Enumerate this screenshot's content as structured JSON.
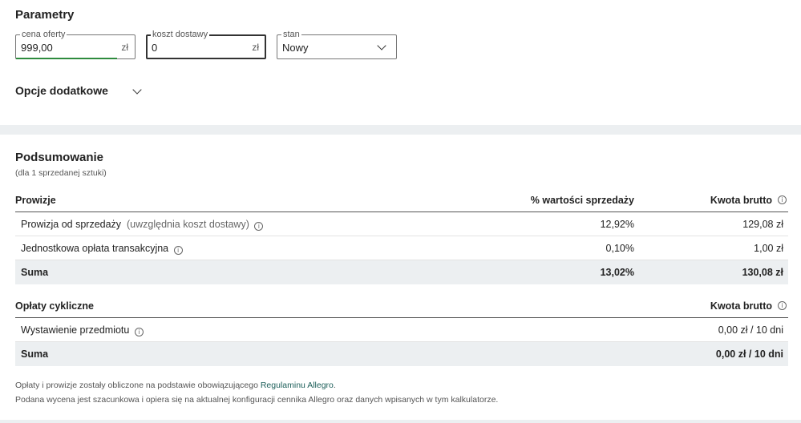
{
  "params": {
    "title": "Parametry",
    "price": {
      "label": "cena oferty",
      "value": "999,00",
      "unit": "zł"
    },
    "shipping": {
      "label": "koszt dostawy",
      "value": "0",
      "unit": "zł"
    },
    "condition": {
      "label": "stan",
      "value": "Nowy"
    },
    "extra_options": "Opcje dodatkowe"
  },
  "summary": {
    "title": "Podsumowanie",
    "subtitle": "(dla 1 sprzedanej sztuki)",
    "commissions": {
      "headers": [
        "Prowizje",
        "% wartości sprzedaży",
        "Kwota brutto"
      ],
      "rows": [
        {
          "label": "Prowizja od sprzedaży",
          "note": "(uwzględnia koszt dostawy)",
          "percent": "12,92%",
          "amount": "129,08 zł"
        },
        {
          "label": "Jednostkowa opłata transakcyjna",
          "percent": "0,10%",
          "amount": "1,00 zł"
        }
      ],
      "sum": {
        "label": "Suma",
        "percent": "13,02%",
        "amount": "130,08 zł"
      }
    },
    "cyclic": {
      "headers": [
        "Opłaty cykliczne",
        "Kwota brutto"
      ],
      "rows": [
        {
          "label": "Wystawienie przedmiotu",
          "amount": "0,00 zł / 10 dni"
        }
      ],
      "sum": {
        "label": "Suma",
        "amount": "0,00 zł / 10 dni"
      }
    },
    "footnote1_pre": "Opłaty i prowizje zostały obliczone na podstawie obowiązującego ",
    "footnote1_link": "Regulaminu Allegro",
    "footnote1_post": ".",
    "footnote2": "Podana wycena jest szacunkowa i opiera się na aktualnej konfiguracji cennika Allegro oraz danych wpisanych w tym kalkulatorze."
  },
  "icons": {
    "info": "info-icon",
    "chevron": "chevron-down-icon"
  },
  "colors": {
    "accent_green": "#2e8b3e",
    "link": "#1d5f5a",
    "band": "#eceff1"
  }
}
